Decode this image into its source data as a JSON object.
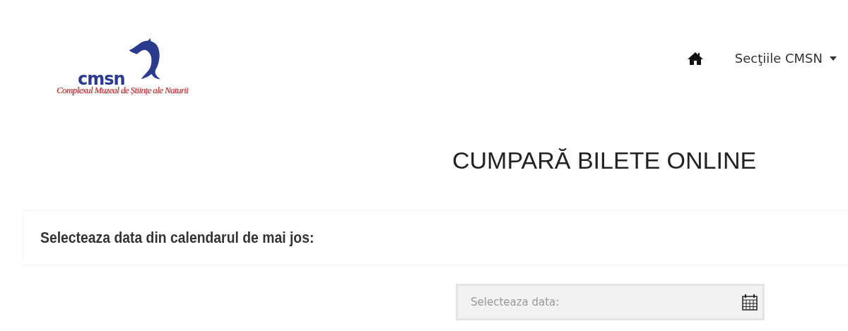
{
  "logo": {
    "short": "cmsn",
    "full": "Complexul Muzeal de Științe ale Naturii"
  },
  "nav": {
    "items": [
      {
        "kind": "home"
      },
      {
        "kind": "dropdown",
        "label": "Secţiile CMSN"
      }
    ]
  },
  "title": "CUMPARĂ BILETE ONLINE",
  "panel": {
    "heading": "Selecteaza data din calendarul de mai jos:"
  },
  "date_field": {
    "placeholder": "Selecteaza data:"
  }
}
